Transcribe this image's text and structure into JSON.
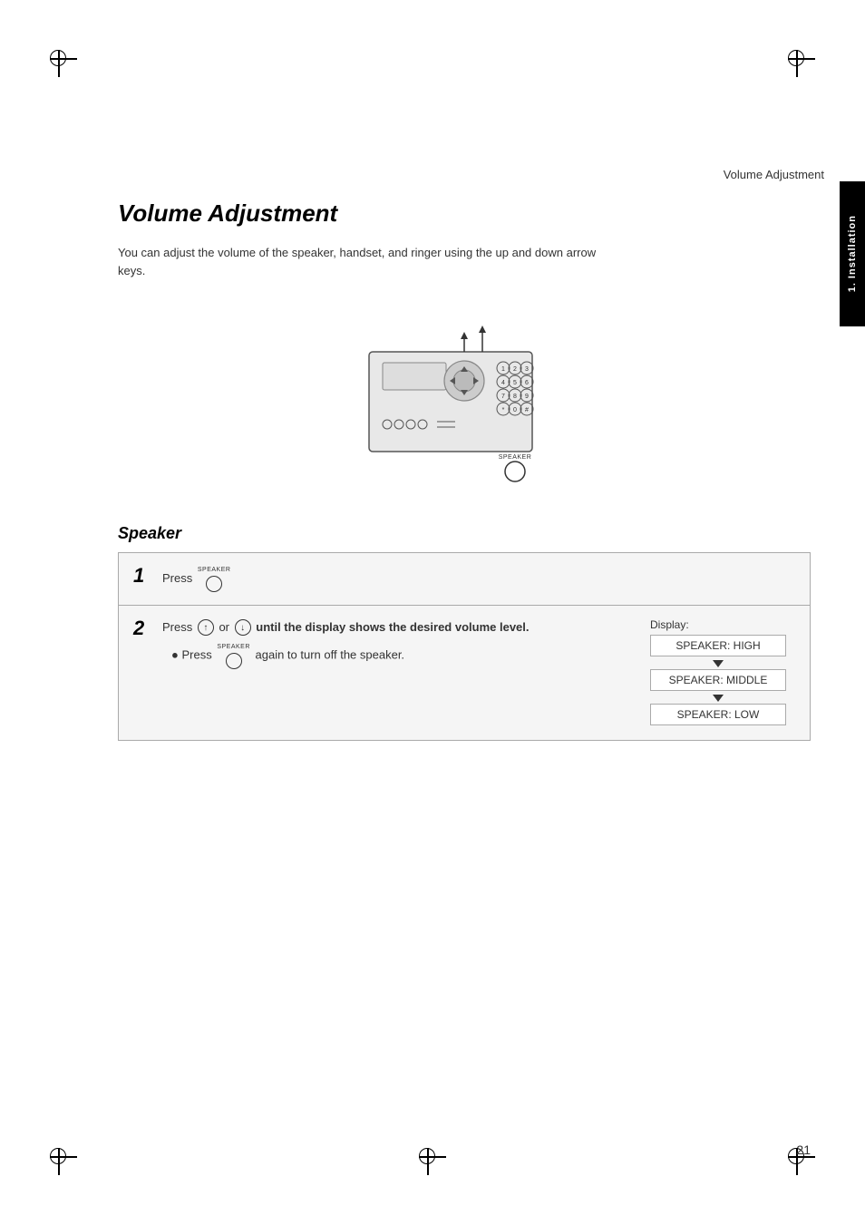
{
  "header": {
    "title": "Volume Adjustment",
    "tab_label": "1. Installation",
    "page_number": "21"
  },
  "page_title": "Volume Adjustment",
  "description": "You can adjust the volume of the speaker, handset, and ringer using the up and down arrow keys.",
  "section_title": "Speaker",
  "steps": [
    {
      "number": "1",
      "text": "Press",
      "has_speaker_btn": true,
      "has_display": false
    },
    {
      "number": "2",
      "main_text": "Press  or  until the display shows the desired volume level.",
      "bullet_text": "Press  again to turn off the speaker.",
      "has_display": true,
      "display_label": "Display:",
      "display_items": [
        "SPEAKER: HIGH",
        "SPEAKER: MIDDLE",
        "SPEAKER: LOW"
      ]
    }
  ]
}
